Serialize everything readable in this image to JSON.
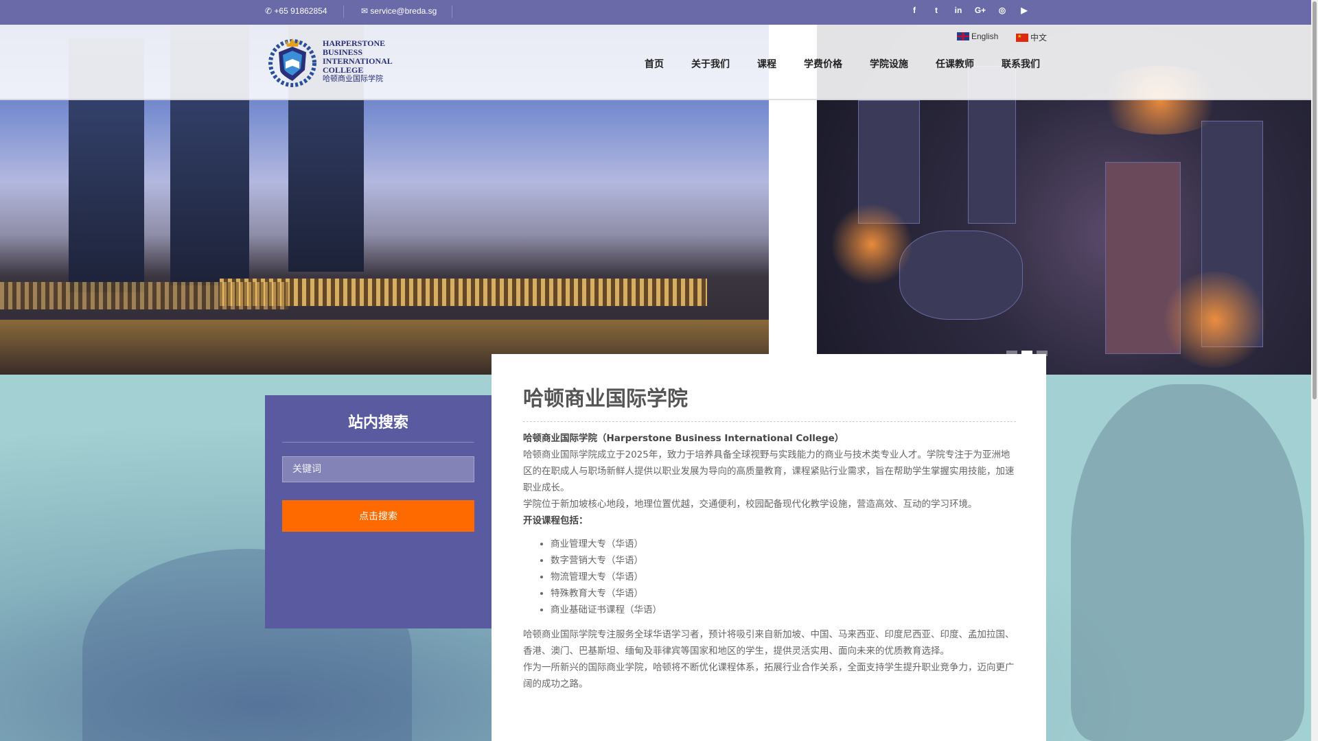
{
  "topbar": {
    "phone": "+65 91862854",
    "email": "service@breda.sg",
    "social": [
      {
        "icon": "facebook-icon",
        "glyph": "f"
      },
      {
        "icon": "twitter-icon",
        "glyph": "t"
      },
      {
        "icon": "linkedin-icon",
        "glyph": "in"
      },
      {
        "icon": "google-plus-icon",
        "glyph": "G+"
      },
      {
        "icon": "instagram-icon",
        "glyph": "◎"
      },
      {
        "icon": "youtube-icon",
        "glyph": "▶"
      }
    ]
  },
  "logo": {
    "line1": "HARPERSTONE BUSINESS",
    "line2": "INTERNATIONAL COLLEGE",
    "line3": "哈顿商业国际学院"
  },
  "lang": {
    "english": "English",
    "chinese": "中文"
  },
  "nav": [
    "首页",
    "关于我们",
    "课程",
    "学费价格",
    "学院设施",
    "任课教师",
    "联系我们"
  ],
  "search": {
    "title": "站内搜索",
    "placeholder": "关键词",
    "button": "点击搜索"
  },
  "content": {
    "title": "哈顿商业国际学院",
    "intro_heading": "哈顿商业国际学院（Harperstone Business International College）",
    "para1": "哈顿商业国际学院成立于2025年，致力于培养具备全球视野与实践能力的商业与技术类专业人才。学院专注于为亚洲地区的在职成人与职场新鲜人提供以职业发展为导向的高质量教育，课程紧贴行业需求，旨在帮助学生掌握实用技能，加速职业成长。",
    "para2": "学院位于新加坡核心地段，地理位置优越，交通便利，校园配备现代化教学设施，营造高效、互动的学习环境。",
    "courses_heading": "开设课程包括：",
    "courses": [
      "商业管理大专（华语）",
      "数字营销大专（华语）",
      "物流管理大专（华语）",
      "特殊教育大专（华语）",
      "商业基础证书课程（华语）"
    ],
    "para3": "哈顿商业国际学院专注服务全球华语学习者，预计将吸引来自新加坡、中国、马来西亚、印度尼西亚、印度、孟加拉国、香港、澳门、巴基斯坦、缅甸及菲律宾等国家和地区的学生，提供灵活实用、面向未来的优质教育选择。",
    "para4": "作为一所新兴的国际商业学院，哈顿将不断优化课程体系，拓展行业合作关系，全面支持学生提升职业竞争力，迈向更广阔的成功之路。"
  },
  "colors": {
    "topbar": "#6b6aa8",
    "search_panel": "#5a5aa0",
    "search_button": "#ff6a00"
  }
}
